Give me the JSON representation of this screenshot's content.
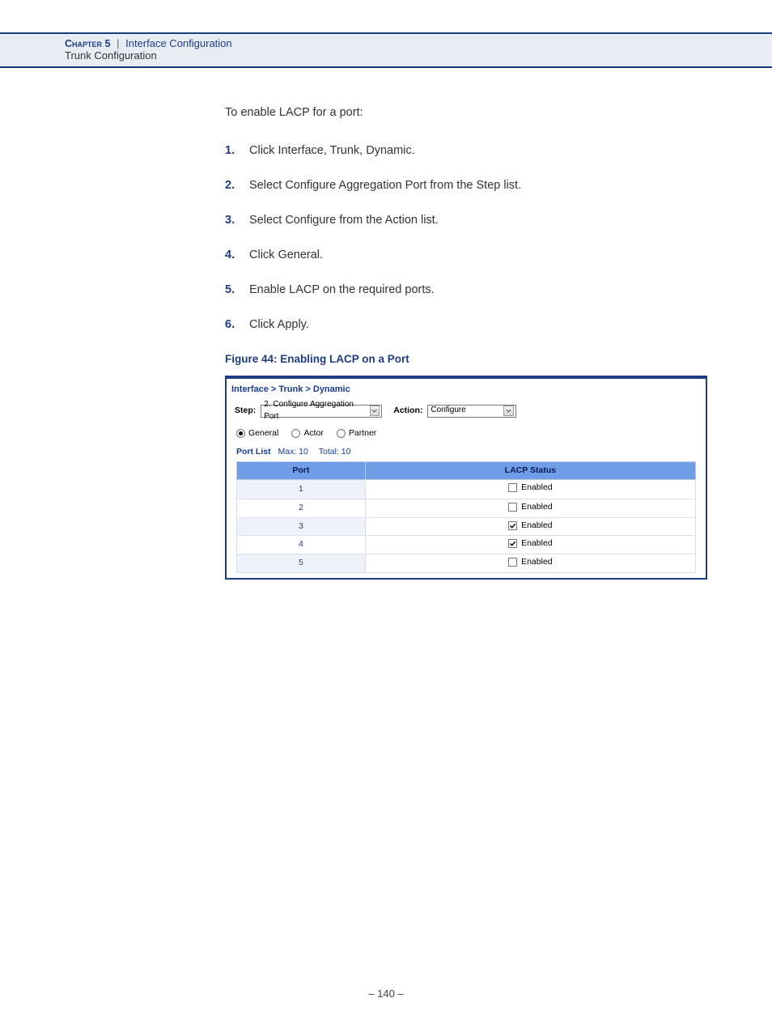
{
  "header": {
    "chapter_label": "Chapter 5",
    "separator": "|",
    "chapter_title": "Interface Configuration",
    "subsection": "Trunk Configuration"
  },
  "body": {
    "intro": "To enable LACP for a port:",
    "steps": [
      "Click Interface, Trunk, Dynamic.",
      "Select Configure Aggregation Port from the Step list.",
      "Select Configure from the Action list.",
      "Click General.",
      "Enable LACP on the required ports.",
      "Click Apply."
    ],
    "figure_caption": "Figure 44:  Enabling LACP on a Port"
  },
  "figure": {
    "breadcrumb": "Interface > Trunk > Dynamic",
    "step_label": "Step:",
    "step_value": "2. Configure Aggregation Port",
    "action_label": "Action:",
    "action_value": "Configure",
    "radios": [
      {
        "label": "General",
        "checked": true
      },
      {
        "label": "Actor",
        "checked": false
      },
      {
        "label": "Partner",
        "checked": false
      }
    ],
    "port_list_label": "Port List",
    "port_list_max": "Max: 10",
    "port_list_total": "Total: 10",
    "table_headers": {
      "port": "Port",
      "status": "LACP Status"
    },
    "status_label": "Enabled",
    "rows": [
      {
        "port": "1",
        "checked": false
      },
      {
        "port": "2",
        "checked": false
      },
      {
        "port": "3",
        "checked": true
      },
      {
        "port": "4",
        "checked": true
      },
      {
        "port": "5",
        "checked": false
      }
    ]
  },
  "footer": {
    "page_number": "–  140  –"
  }
}
